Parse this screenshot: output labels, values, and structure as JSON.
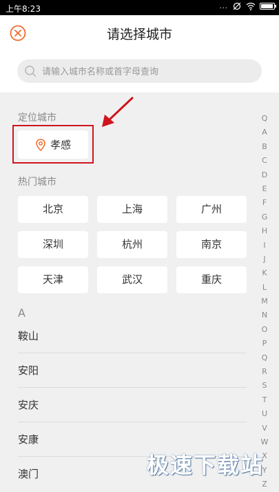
{
  "status_bar": {
    "time": "上午8:23",
    "dots": "...",
    "icons": [
      "signal-icon",
      "wifi-icon",
      "battery-icon"
    ]
  },
  "header": {
    "title": "请选择城市",
    "close_icon": "close-circle-icon",
    "accent_color": "#f26b2a"
  },
  "search": {
    "placeholder": "请输入城市名称或首字母查询"
  },
  "location": {
    "label": "定位城市",
    "city": "孝感",
    "icon": "location-pin-icon"
  },
  "hot": {
    "label": "热门城市",
    "cities": [
      "北京",
      "上海",
      "广州",
      "深圳",
      "杭州",
      "南京",
      "天津",
      "武汉",
      "重庆"
    ]
  },
  "list": {
    "letter": "A",
    "cities": [
      "鞍山",
      "安阳",
      "安庆",
      "安康",
      "澳门"
    ]
  },
  "index": [
    "Q",
    "A",
    "B",
    "C",
    "D",
    "E",
    "F",
    "G",
    "H",
    "I",
    "J",
    "K",
    "L",
    "M",
    "N",
    "O",
    "P",
    "Q",
    "R",
    "S",
    "T",
    "U",
    "V",
    "W",
    "X",
    "Y",
    "Z"
  ],
  "annotation": {
    "highlight_color": "#d0141c"
  },
  "watermark": "极速下载站"
}
